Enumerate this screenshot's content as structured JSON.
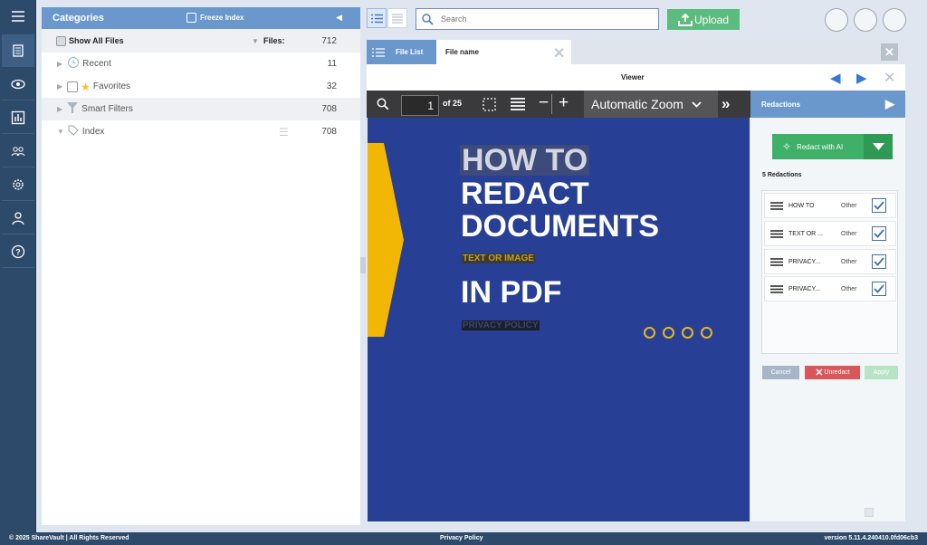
{
  "rail": {
    "items": [
      "menu-icon",
      "documents-icon",
      "tracking-icon",
      "reports-icon",
      "users-icon",
      "settings-icon",
      "profile-icon",
      "help-icon"
    ]
  },
  "categories": {
    "title": "Categories",
    "freeze_label": "Freeze Index",
    "show_all": "Show All Files",
    "files_label": "Files:",
    "files_count": "712",
    "rows": [
      {
        "label": "Recent",
        "count": "11",
        "icon": "clock-icon"
      },
      {
        "label": "Favorites",
        "count": "32",
        "icon": "star-icon"
      },
      {
        "label": "Smart Filters",
        "count": "708",
        "icon": "filter-icon"
      },
      {
        "label": "Index",
        "count": "708",
        "icon": "tag-icon"
      }
    ]
  },
  "toolbar": {
    "search_placeholder": "Search",
    "upload_label": "Upload"
  },
  "tabs": {
    "file_list": "File List",
    "file_name": "File name"
  },
  "viewer": {
    "title": "Viewer"
  },
  "pdf": {
    "page": "1",
    "of_pages": "of 25",
    "zoom": "Automatic Zoom"
  },
  "document": {
    "line1": "HOW TO",
    "line2": "REDACT",
    "line3": "DOCUMENTS",
    "line4": "TEXT OR IMAGE",
    "line5": "IN PDF",
    "line6": "PRIVACY POLICY"
  },
  "redactions": {
    "title": "Redactions",
    "ai_button": "Redact with AI",
    "count_label": "5 Redactions",
    "items": [
      {
        "label": "HOW TO",
        "type": "Other"
      },
      {
        "label": "TEXT OR ...",
        "type": "Other"
      },
      {
        "label": "PRIVACY...",
        "type": "Other"
      },
      {
        "label": "PRIVACY...",
        "type": "Other"
      }
    ],
    "cancel": "Cancel",
    "unredact": "Unredact",
    "apply": "Apply"
  },
  "footer": {
    "copyright": "© 2025 ShareVault | All Rights Reserved",
    "privacy": "Privacy Policy",
    "version": "version 5.11.4.240410.0fd06cb3"
  },
  "colors": {
    "accent": "#6a98cc",
    "rail": "#2e4a6b",
    "upload": "#5cbb7f",
    "doc_bg": "#273f95",
    "doc_arrow": "#f2b705"
  }
}
